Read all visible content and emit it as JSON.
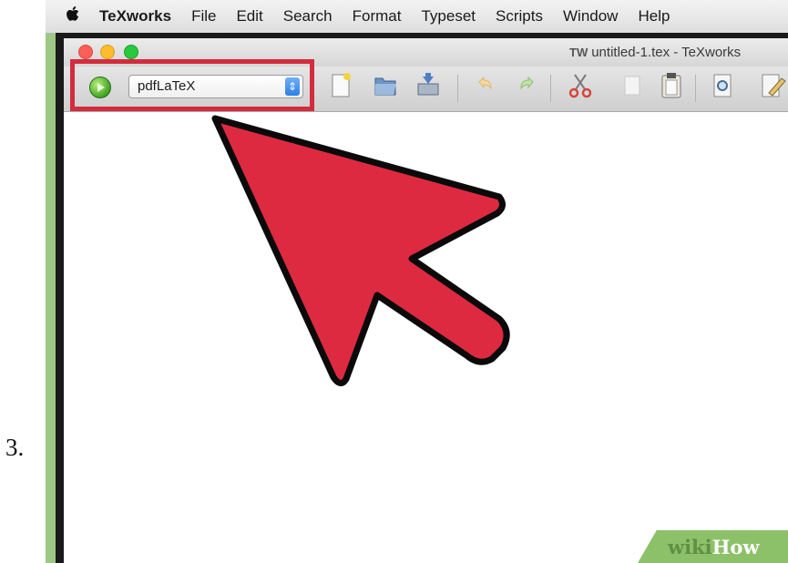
{
  "step": {
    "number": "3."
  },
  "menubar": {
    "apple_icon": "apple-logo",
    "app_name": "TeXworks",
    "items": [
      "File",
      "Edit",
      "Search",
      "Format",
      "Typeset",
      "Scripts",
      "Window",
      "Help"
    ]
  },
  "window": {
    "title_icon_text": "TW",
    "title": "untitled-1.tex - TeXworks"
  },
  "toolbar": {
    "typeset_icon": "play-circle-icon",
    "engine_value": "pdfLaTeX",
    "engine_arrows": "⇕",
    "buttons": [
      "new-document-icon",
      "open-folder-icon",
      "save-icon",
      "undo-icon",
      "redo-icon",
      "cut-icon",
      "copy-icon",
      "paste-icon",
      "find-icon",
      "edit-pen-icon"
    ]
  },
  "colors": {
    "highlight": "#d42b3d",
    "arrow_fill": "#dd2a41",
    "frame_green": "#9dc984"
  },
  "watermark": {
    "part1": "wiki",
    "part2": "How"
  }
}
